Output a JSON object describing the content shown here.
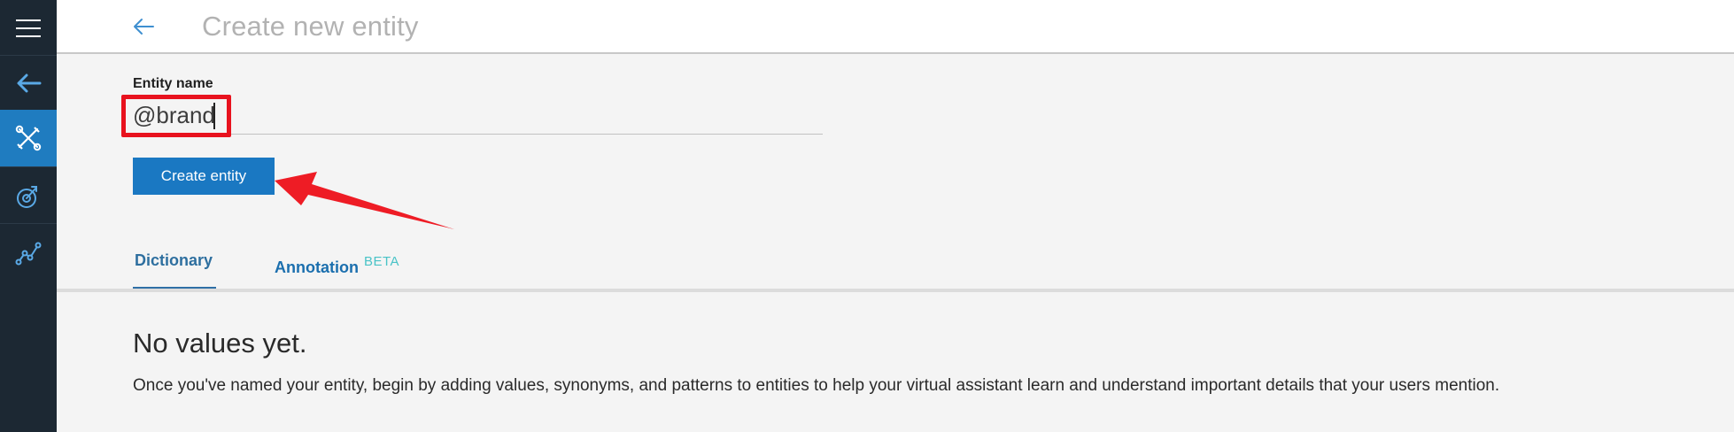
{
  "header": {
    "title": "Create new entity",
    "back_icon": "arrow-left-icon"
  },
  "rail": {
    "items": [
      {
        "icon": "menu-icon"
      },
      {
        "icon": "arrow-left-icon"
      },
      {
        "icon": "tools-icon",
        "active": true
      },
      {
        "icon": "versions-icon"
      },
      {
        "icon": "analytics-icon"
      }
    ]
  },
  "form": {
    "label": "Entity name",
    "value": "@brand",
    "button_label": "Create entity"
  },
  "tabs": {
    "dictionary": "Dictionary",
    "annotation": "Annotation",
    "beta": "BETA"
  },
  "empty_state": {
    "title": "No values yet.",
    "description": "Once you've named your entity, begin by adding values, synonyms, and patterns to entities to help your virtual assistant learn and understand important details that your users mention."
  },
  "colors": {
    "rail": "#1c2833",
    "accent": "#1a78c2",
    "highlight": "#e8121e",
    "beta": "#49c3c7"
  }
}
